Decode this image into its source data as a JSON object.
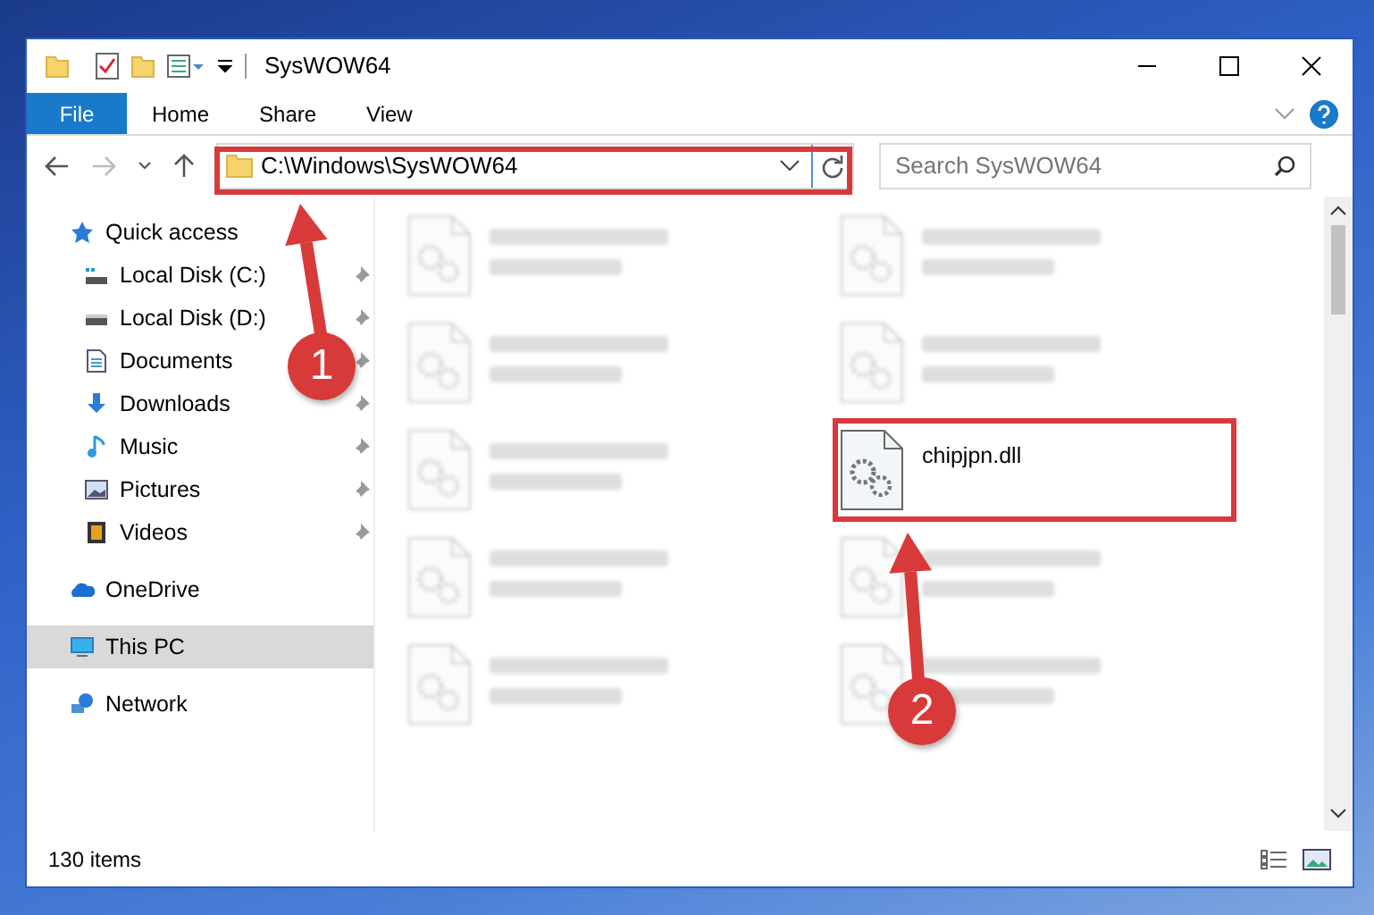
{
  "window": {
    "title": "SysWOW64"
  },
  "ribbon_tabs": [
    {
      "label": "File",
      "kind": "file"
    },
    {
      "label": "Home",
      "kind": "tab"
    },
    {
      "label": "Share",
      "kind": "tab"
    },
    {
      "label": "View",
      "kind": "tab"
    }
  ],
  "address": {
    "path": "C:\\Windows\\SysWOW64"
  },
  "search": {
    "placeholder": "Search SysWOW64"
  },
  "sidebar": {
    "groups": [
      {
        "label": "Quick access",
        "selected": false,
        "children": [
          {
            "label": "Local Disk (C:)",
            "pinned": true
          },
          {
            "label": "Local Disk (D:)",
            "pinned": true
          },
          {
            "label": "Documents",
            "pinned": true
          },
          {
            "label": "Downloads",
            "pinned": true
          },
          {
            "label": "Music",
            "pinned": true
          },
          {
            "label": "Pictures",
            "pinned": true
          },
          {
            "label": "Videos",
            "pinned": true
          }
        ]
      },
      {
        "label": "OneDrive",
        "selected": false
      },
      {
        "label": "This PC",
        "selected": true
      },
      {
        "label": "Network",
        "selected": false
      }
    ]
  },
  "files": [
    {
      "blurred": true
    },
    {
      "blurred": true
    },
    {
      "blurred": true
    },
    {
      "blurred": true
    },
    {
      "blurred": true
    },
    {
      "name": "chipjpn.dll",
      "blurred": false,
      "highlighted": true
    },
    {
      "blurred": true
    },
    {
      "blurred": true
    },
    {
      "blurred": true
    },
    {
      "blurred": true
    }
  ],
  "status_bar": {
    "count": "130 items"
  },
  "annotations": [
    {
      "number": "1"
    },
    {
      "number": "2"
    }
  ]
}
